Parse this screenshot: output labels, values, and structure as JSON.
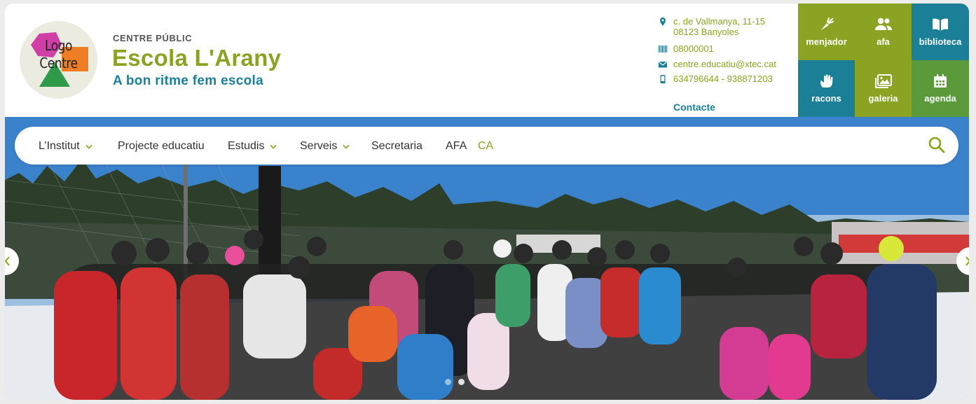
{
  "header": {
    "logo_text_line1": "Logo",
    "logo_text_line2": "Centre",
    "tag": "CENTRE PÚBLIC",
    "name": "Escola L'Arany",
    "slogan": "A bon ritme fem escola"
  },
  "contact": {
    "address_line1": "c. de Vallmanya, 11-15",
    "address_line2": "08123 Banyoles",
    "code": "08000001",
    "email": "centre.educatiu@xtec.cat",
    "phone": "634796644 - 938871203",
    "contact_link": "Contacte"
  },
  "tiles": [
    {
      "label": "menjador",
      "icon": "carrot-icon",
      "color": "#8aa322"
    },
    {
      "label": "afa",
      "icon": "users-icon",
      "color": "#8aa322"
    },
    {
      "label": "biblioteca",
      "icon": "book-icon",
      "color": "#1b7f97"
    },
    {
      "label": "racons",
      "icon": "hand-icon",
      "color": "#1b7f97"
    },
    {
      "label": "galeria",
      "icon": "images-icon",
      "color": "#8aa322"
    },
    {
      "label": "agenda",
      "icon": "calendar-icon",
      "color": "#5a9a3a"
    }
  ],
  "nav": {
    "items": [
      {
        "label": "L’Institut",
        "dropdown": true
      },
      {
        "label": "Projecte educatiu",
        "dropdown": false
      },
      {
        "label": "Estudis",
        "dropdown": true
      },
      {
        "label": "Serveis",
        "dropdown": true
      },
      {
        "label": "Secretaria",
        "dropdown": false
      },
      {
        "label": "AFA",
        "dropdown": false
      }
    ],
    "language": "CA"
  },
  "colors": {
    "green": "#8aa322",
    "teal": "#1b7f97",
    "dark_green": "#5a9a3a"
  },
  "carousel": {
    "slides": 2,
    "active_slide": 2
  }
}
